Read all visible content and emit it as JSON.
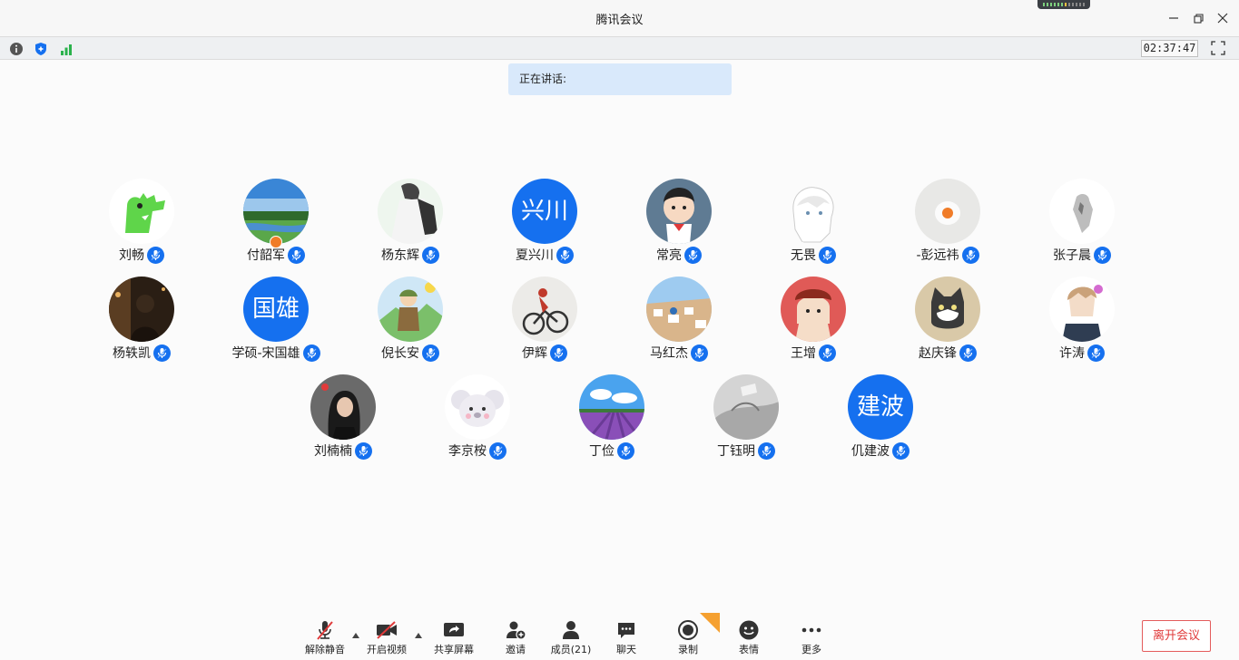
{
  "window": {
    "title": "腾讯会议"
  },
  "infobar": {
    "timer": "02:37:47"
  },
  "speaking": {
    "label": "正在讲话:"
  },
  "participants": [
    {
      "name": "刘畅",
      "avatar": "crocodile"
    },
    {
      "name": "付韶军",
      "avatar": "landscape"
    },
    {
      "name": "杨东辉",
      "avatar": "backpacker"
    },
    {
      "name": "夏兴川",
      "avatar_text": "兴川"
    },
    {
      "name": "常亮",
      "avatar": "baby"
    },
    {
      "name": "无畏",
      "avatar": "anime"
    },
    {
      "name": "-彭远祎",
      "avatar": "egg"
    },
    {
      "name": "张子晨",
      "avatar": "sketch"
    },
    {
      "name": "杨轶凯",
      "avatar": "night"
    },
    {
      "name": "学硕-宋国雄",
      "avatar_text": "国雄"
    },
    {
      "name": "倪长安",
      "avatar": "cartoon-hiker"
    },
    {
      "name": "伊辉",
      "avatar": "cyclist"
    },
    {
      "name": "马红杰",
      "avatar": "santorini"
    },
    {
      "name": "王增",
      "avatar": "red-cartoon"
    },
    {
      "name": "赵庆锋",
      "avatar": "cat"
    },
    {
      "name": "许涛",
      "avatar": "anime-boy"
    },
    {
      "name": "刘楠楠",
      "avatar": "woman"
    },
    {
      "name": "李京桉",
      "avatar": "koala"
    },
    {
      "name": "丁俭",
      "avatar": "lavender"
    },
    {
      "name": "丁钰明",
      "avatar": "gray"
    },
    {
      "name": "仉建波",
      "avatar_text": "建波"
    }
  ],
  "toolbar": {
    "unmute": "解除静音",
    "video": "开启视频",
    "share": "共享屏幕",
    "invite": "邀请",
    "members": "成员(21)",
    "chat": "聊天",
    "record": "录制",
    "emoji": "表情",
    "more": "更多",
    "leave": "离开会议"
  },
  "colors": {
    "accent": "#1570ef",
    "leave": "#e03a3a",
    "speaking_bg": "#d9e9fb"
  }
}
